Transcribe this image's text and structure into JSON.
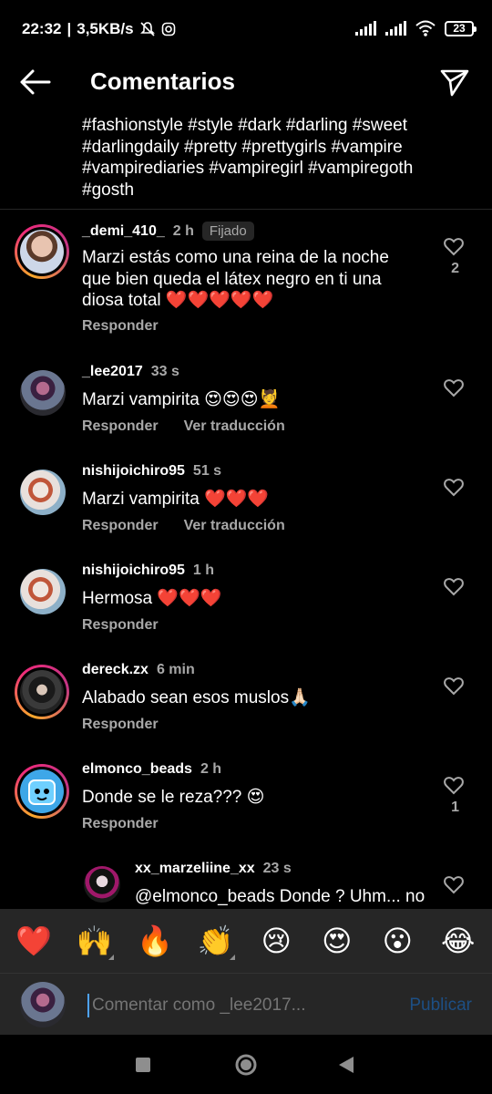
{
  "status": {
    "time": "22:32",
    "speed": "3,5KB/s",
    "battery": "23"
  },
  "header": {
    "title": "Comentarios"
  },
  "caption": "#fashionstyle #style #dark #darling #sweet #darlingdaily #pretty #prettygirls #vampire #vampirediaries #vampiregirl #vampiregoth #gosth",
  "comments": [
    {
      "user": "_demi_410_",
      "time": "2 h",
      "badge": "Fijado",
      "text": "Marzi estás como una reina de la noche que bien queda el látex negro en ti una diosa total ❤️❤️❤️❤️❤️",
      "reply": "Responder",
      "likes": "2"
    },
    {
      "user": "_lee2017",
      "time": "33 s",
      "text": "Marzi vampirita 😍😍😍💆",
      "reply": "Responder",
      "translate": "Ver traducción"
    },
    {
      "user": "nishijoichiro95",
      "time": "51 s",
      "text": "Marzi vampirita ❤️❤️❤️",
      "reply": "Responder",
      "translate": "Ver traducción"
    },
    {
      "user": "nishijoichiro95",
      "time": "1 h",
      "text": "Hermosa ❤️❤️❤️",
      "reply": "Responder"
    },
    {
      "user": "dereck.zx",
      "time": "6 min",
      "text": "Alabado sean esos muslos🙏🏻",
      "reply": "Responder"
    },
    {
      "user": "elmonco_beads",
      "time": "2 h",
      "text": "Donde se le reza??? 😍",
      "reply": "Responder",
      "likes": "1"
    },
    {
      "user": "xx_marzeliine_xx",
      "time": "23 s",
      "text": "@elmonco_beads Donde ? Uhm... no"
    }
  ],
  "emojis": [
    "❤️",
    "🙌",
    "🔥",
    "👏",
    "😢",
    "😍",
    "😮",
    "😂"
  ],
  "composer": {
    "placeholder": "Comentar como _lee2017...",
    "publish": "Publicar"
  },
  "colors": {
    "background": "#000000",
    "secondary_text": "#a8a8a8",
    "panel": "#262626",
    "publish_disabled": "#1d4f84",
    "story_ring": "#ee2a7b"
  }
}
